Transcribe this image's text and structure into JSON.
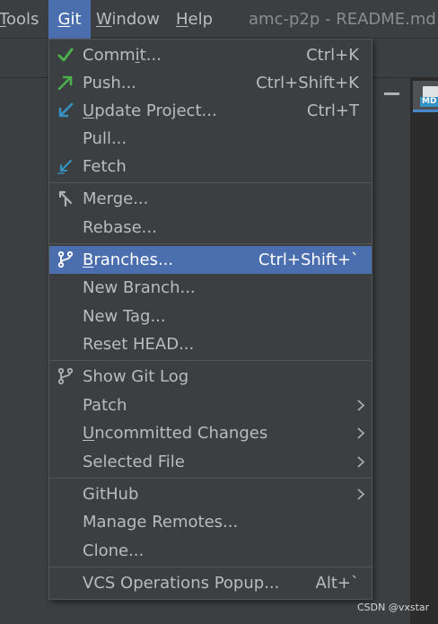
{
  "menubar": {
    "tools": {
      "pre": "",
      "mn": "T",
      "post": "ools"
    },
    "git": {
      "pre": "",
      "mn": "G",
      "post": "it"
    },
    "window": {
      "pre": "",
      "mn": "W",
      "post": "indow"
    },
    "help": {
      "pre": "",
      "mn": "H",
      "post": "elp"
    },
    "title": "amc-p2p - README.md"
  },
  "editor_tab": {
    "badge": "MD"
  },
  "colors": {
    "menu_bg": "#3c3f41",
    "selection": "#4b6eaf",
    "text": "#bbbbbb",
    "icon_green": "#4cae4c",
    "icon_blue": "#3592c4",
    "icon_gray": "#afb1b3"
  },
  "git_menu": {
    "commit": {
      "icon": "checkmark-icon",
      "pre": "Comm",
      "mn": "i",
      "post": "t...",
      "shortcut": "Ctrl+K"
    },
    "push": {
      "icon": "push-arrow-icon",
      "pre": "",
      "mn": "",
      "post": "Push...",
      "shortcut": "Ctrl+Shift+K"
    },
    "update": {
      "icon": "update-arrow-icon",
      "pre": "",
      "mn": "U",
      "post": "pdate Project...",
      "shortcut": "Ctrl+T"
    },
    "pull": {
      "pre": "",
      "mn": "",
      "post": "Pull..."
    },
    "fetch": {
      "icon": "fetch-icon",
      "pre": "",
      "mn": "",
      "post": "Fetch"
    },
    "merge": {
      "icon": "merge-icon",
      "pre": "",
      "mn": "",
      "post": "Merge..."
    },
    "rebase": {
      "pre": "",
      "mn": "",
      "post": "Rebase..."
    },
    "branches": {
      "icon": "branch-icon",
      "pre": "",
      "mn": "B",
      "post": "ranches...",
      "shortcut": "Ctrl+Shift+`",
      "selected": true
    },
    "new_branch": {
      "pre": "",
      "mn": "",
      "post": "New Branch..."
    },
    "new_tag": {
      "pre": "",
      "mn": "",
      "post": "New Tag..."
    },
    "reset_head": {
      "pre": "",
      "mn": "",
      "post": "Reset HEAD..."
    },
    "show_git_log": {
      "icon": "git-log-icon",
      "pre": "",
      "mn": "",
      "post": "Show Git Log"
    },
    "patch": {
      "pre": "",
      "mn": "",
      "post": "Patch",
      "submenu": true
    },
    "uncommitted": {
      "pre": "",
      "mn": "U",
      "post": "ncommitted Changes",
      "submenu": true
    },
    "selected_file": {
      "pre": "",
      "mn": "",
      "post": "Selected File",
      "submenu": true
    },
    "github": {
      "pre": "",
      "mn": "",
      "post": "GitHub",
      "submenu": true
    },
    "manage_remotes": {
      "pre": "",
      "mn": "",
      "post": "Manage Remotes..."
    },
    "clone": {
      "pre": "",
      "mn": "",
      "post": "Clone..."
    },
    "vcs_popup": {
      "pre": "",
      "mn": "",
      "post": "VCS Operations Popup...",
      "shortcut": "Alt+`"
    }
  },
  "watermark": "CSDN @vxstar"
}
